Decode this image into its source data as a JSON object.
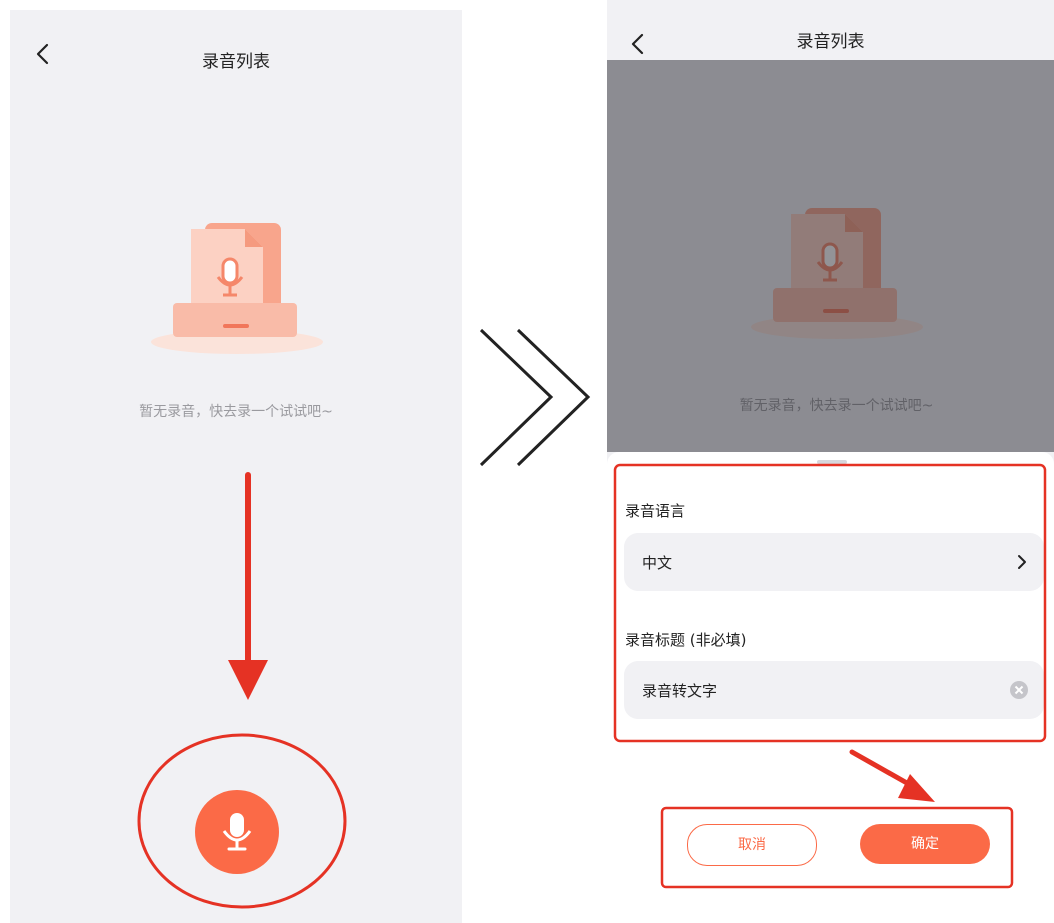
{
  "left": {
    "title": "录音列表",
    "empty_text": "暂无录音，快去录一个试试吧~"
  },
  "right": {
    "title": "录音列表",
    "empty_text": "暂无录音，快去录一个试试吧~",
    "sheet": {
      "language_label": "录音语言",
      "language_value": "中文",
      "title_label": "录音标题 (非必填)",
      "title_value": "录音转文字",
      "cancel_label": "取消",
      "confirm_label": "确定"
    }
  },
  "colors": {
    "accent": "#fb6a47",
    "annotation_red": "#e53224",
    "background": "#f1f1f4"
  },
  "icons": [
    "back-arrow-icon",
    "microphone-icon",
    "chevron-right-icon",
    "clear-icon",
    "double-chevron-icon"
  ]
}
